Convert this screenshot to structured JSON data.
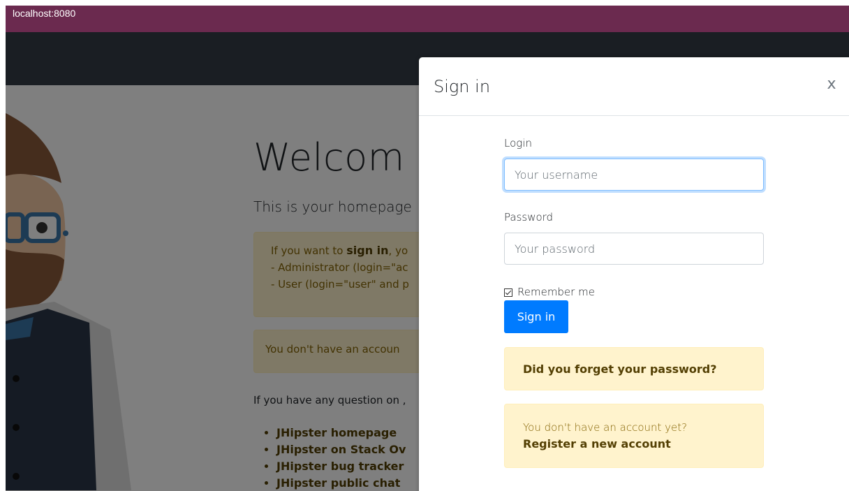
{
  "browser": {
    "url": "localhost:8080"
  },
  "home": {
    "title": "Welcom",
    "lead": "This is your homepage",
    "signin_hint": {
      "prefix": "If you want to ",
      "bold": "sign in",
      "suffix": ", yo",
      "line2": "- Administrator (login=\"ac",
      "line3": "- User (login=\"user\" and p"
    },
    "no_account": "You don't have an accoun",
    "question": "If you have any question on ,",
    "links": [
      "JHipster homepage",
      "JHipster on Stack Ov",
      "JHipster bug tracker",
      "JHipster public chat"
    ]
  },
  "modal": {
    "title": "Sign in",
    "close_label": "x",
    "login_label": "Login",
    "login_placeholder": "Your username",
    "password_label": "Password",
    "password_placeholder": "Your password",
    "remember_label": "Remember me",
    "signin_button": "Sign in",
    "forgot_link": "Did you forget your password?",
    "no_account_text": "You don't have an account yet?",
    "register_link": "Register a new account"
  }
}
